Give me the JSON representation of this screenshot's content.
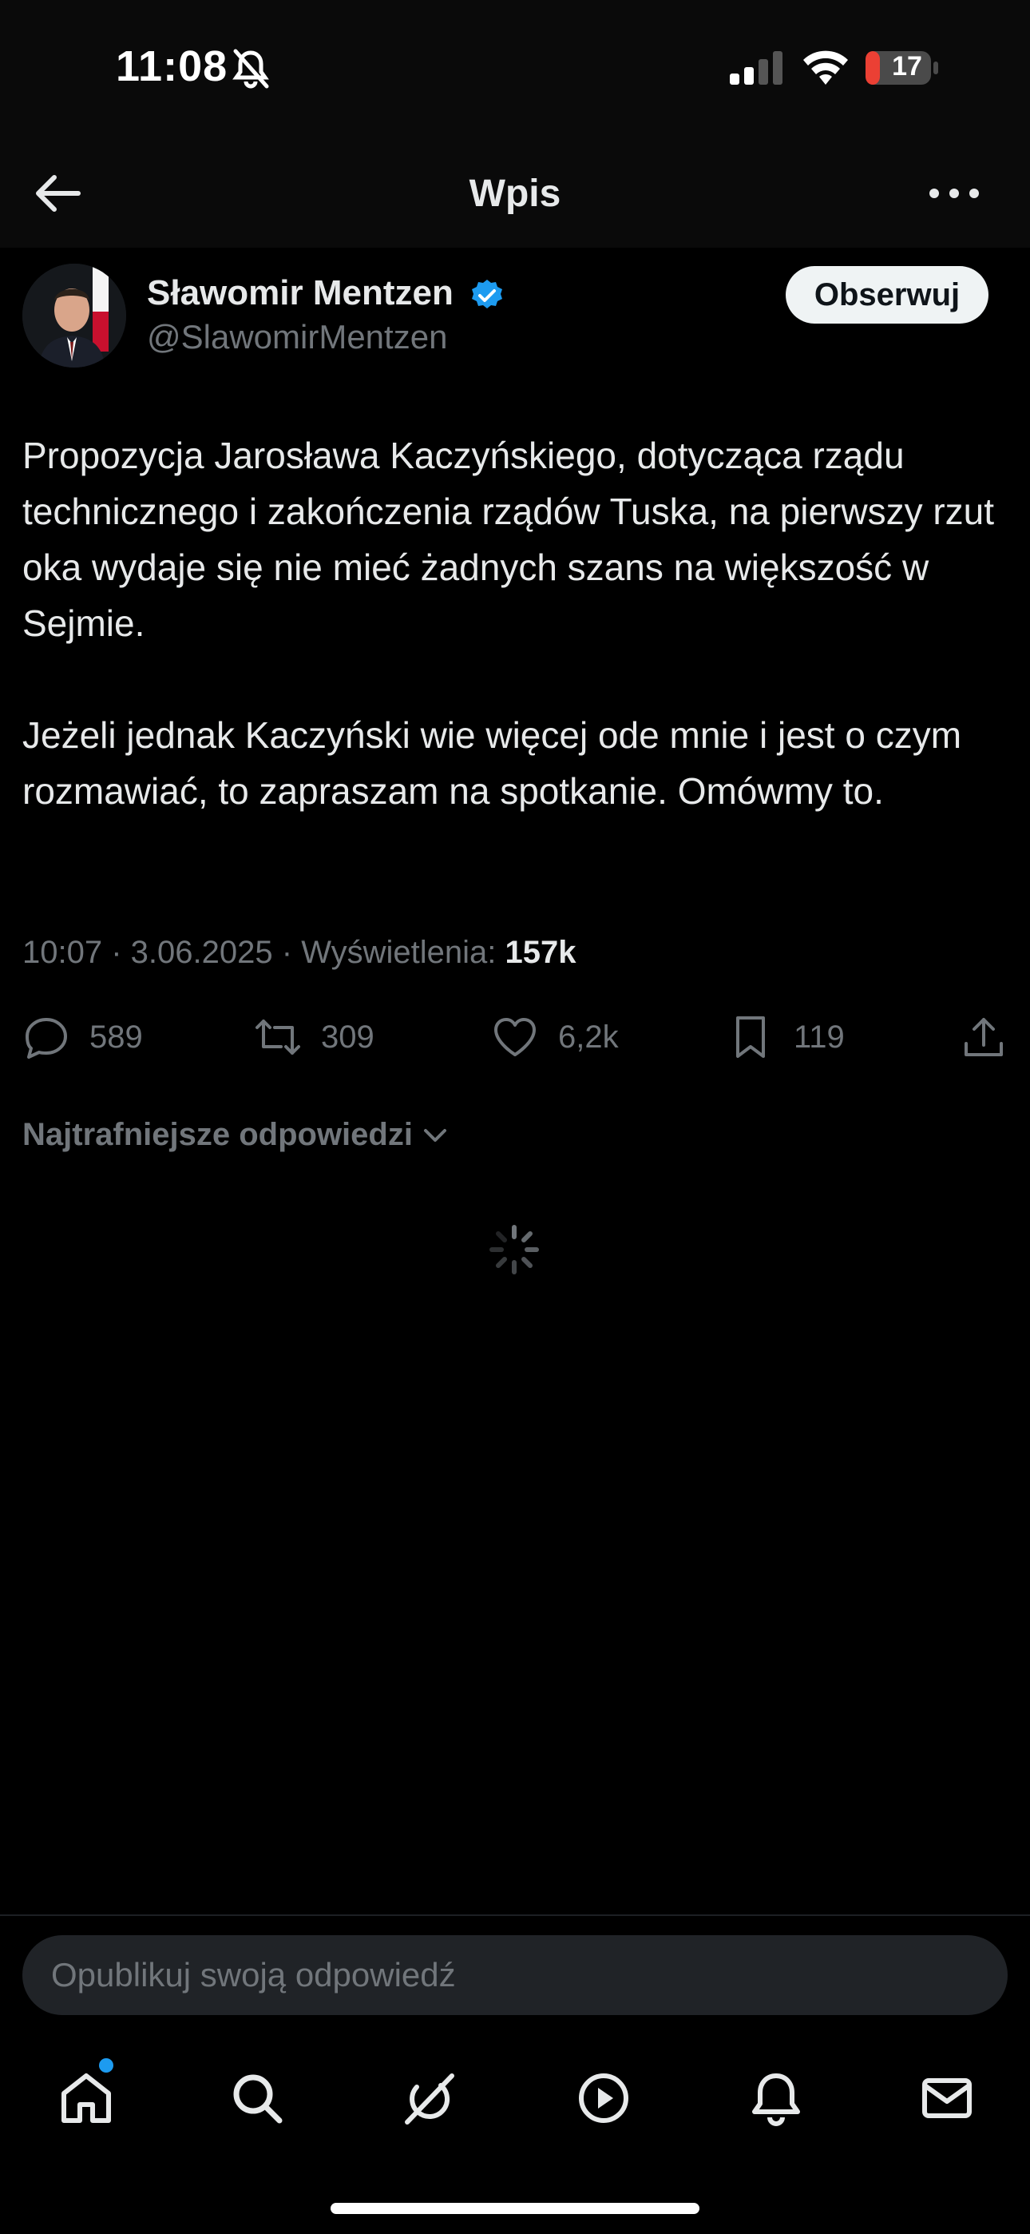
{
  "status_bar": {
    "time": "11:08",
    "battery": "17"
  },
  "header": {
    "title": "Wpis"
  },
  "author": {
    "name": "Sławomir Mentzen",
    "handle": "@SlawomirMentzen",
    "follow_label": "Obserwuj"
  },
  "tweet": {
    "paragraphs": [
      "Propozycja Jarosława Kaczyńskiego, dotycząca rządu technicznego i zakończenia rządów Tuska, na pierwszy rzut oka wydaje się nie mieć żadnych szans na większość w Sejmie.",
      "Jeżeli jednak Kaczyński wie więcej ode mnie i jest o czym rozmawiać, to zapraszam na spotkanie. Omówmy to."
    ],
    "meta": {
      "time": "10:07",
      "date": "3.06.2025",
      "views_label": "Wyświetlenia:",
      "views": "157k"
    }
  },
  "actions": {
    "replies": "589",
    "retweets": "309",
    "likes": "6,2k",
    "bookmarks": "119"
  },
  "replies_sort": {
    "label": "Najtrafniejsze odpowiedzi"
  },
  "reply_box": {
    "placeholder": "Opublikuj swoją odpowiedź"
  },
  "nav": {
    "items": [
      "home-icon",
      "search-icon",
      "grok-icon",
      "video-icon",
      "bell-icon",
      "mail-icon"
    ],
    "accent": "#1d9bf0"
  }
}
